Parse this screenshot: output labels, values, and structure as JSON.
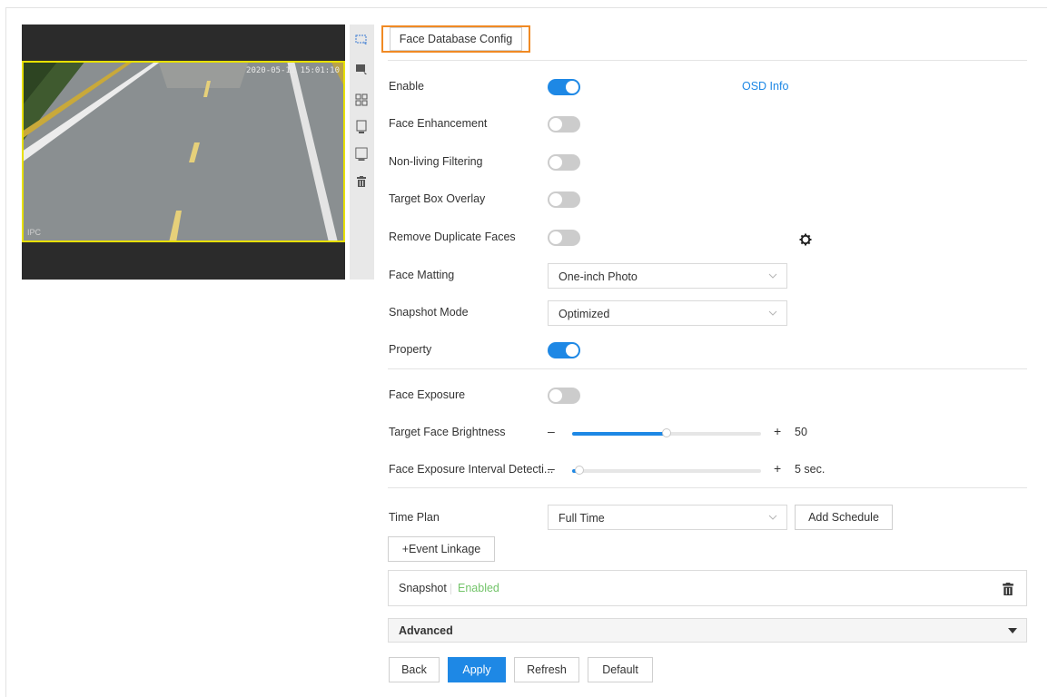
{
  "tab": {
    "label": "Face Database Config"
  },
  "video": {
    "timestamp": "2020-05-11 15:01:10",
    "channel": "IPC"
  },
  "toolbar": {
    "icons": [
      "select-region-icon",
      "select-target-icon",
      "grid-icon",
      "target-box-icon",
      "draw-area-icon",
      "delete-icon"
    ]
  },
  "settings": {
    "enable": {
      "label": "Enable",
      "state": "on",
      "link": "OSD Info"
    },
    "face_enhancement": {
      "label": "Face Enhancement",
      "state": "off"
    },
    "non_living": {
      "label": "Non-living Filtering",
      "state": "off"
    },
    "target_box": {
      "label": "Target Box Overlay",
      "state": "off"
    },
    "remove_duplicate": {
      "label": "Remove Duplicate Faces",
      "state": "off"
    },
    "face_matting": {
      "label": "Face Matting",
      "value": "One-inch Photo"
    },
    "snapshot_mode": {
      "label": "Snapshot Mode",
      "value": "Optimized"
    },
    "property": {
      "label": "Property",
      "state": "on"
    },
    "face_exposure": {
      "label": "Face Exposure",
      "state": "off"
    },
    "brightness": {
      "label": "Target Face Brightness",
      "minus": "–",
      "plus": "+",
      "value": "50",
      "level": 0.5
    },
    "interval": {
      "label": "Face Exposure Interval Detecti...",
      "minus": "–",
      "plus": "+",
      "value": "5 sec.",
      "level": 0.04
    },
    "time_plan": {
      "label": "Time Plan",
      "value": "Full Time",
      "add_schedule": "Add Schedule"
    }
  },
  "event_linkage": "+Event Linkage",
  "snapshot_card": {
    "title": "Snapshot",
    "status": "Enabled"
  },
  "advanced": {
    "label": "Advanced"
  },
  "buttons": {
    "back": "Back",
    "apply": "Apply",
    "refresh": "Refresh",
    "default": "Default"
  },
  "colors": {
    "accent": "#1e88e5",
    "tab_border": "#f08a24",
    "roi": "#e8e000",
    "enabled_text": "#73c46a"
  }
}
